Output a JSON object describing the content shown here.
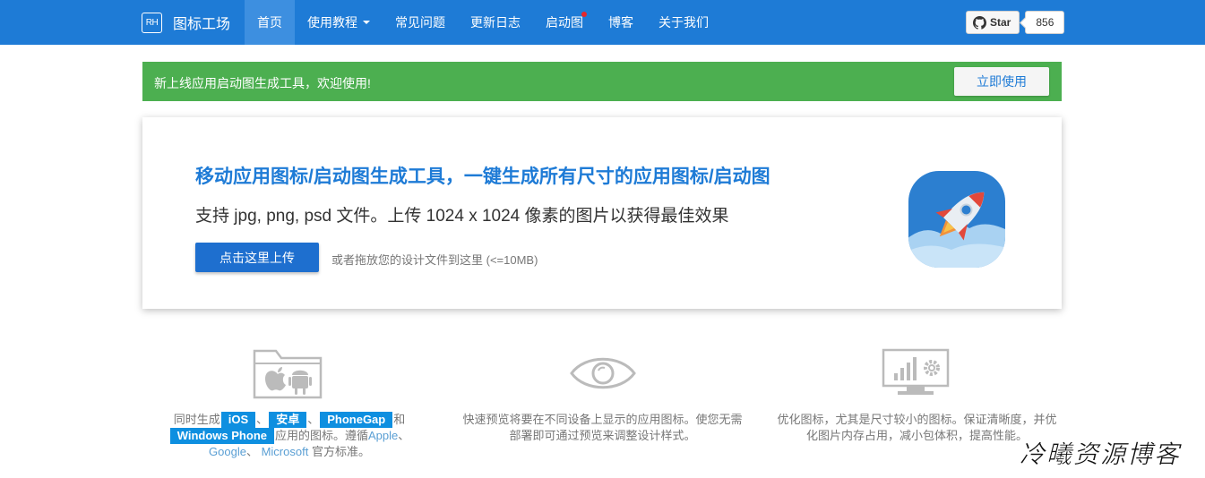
{
  "brand": {
    "logo_text": "RH",
    "name": "图标工场"
  },
  "nav": {
    "items": [
      {
        "label": "首页",
        "active": true
      },
      {
        "label": "使用教程",
        "dropdown": true
      },
      {
        "label": "常见问题"
      },
      {
        "label": "更新日志"
      },
      {
        "label": "启动图",
        "badge_dot": true
      },
      {
        "label": "博客"
      },
      {
        "label": "关于我们"
      }
    ]
  },
  "github": {
    "star_label": "Star",
    "star_count": "856"
  },
  "alert": {
    "text": "新上线应用启动图生成工具，欢迎使用!",
    "button": "立即使用"
  },
  "hero": {
    "title": "移动应用图标/启动图生成工具，一键生成所有尺寸的应用图标/启动图",
    "subtitle": "支持 jpg, png, psd 文件。上传 1024 x 1024 像素的图片以获得最佳效果",
    "upload_button": "点击这里上传",
    "drag_hint": "或者拖放您的设计文件到这里 (<=10MB)"
  },
  "features": {
    "f1": {
      "pre": "同时生成",
      "tag_ios": "iOS",
      "sep1": "、",
      "tag_android": "安卓",
      "sep2": "、",
      "tag_phonegap": "PhoneGap",
      "and": "和",
      "tag_wp": "Windows Phone",
      "mid": "应用的图标。遵循",
      "link_apple": "Apple",
      "sep3": "、",
      "link_google": "Google",
      "sep4": "、",
      "link_ms": "Microsoft",
      "post": "官方标准。"
    },
    "f2": {
      "line1": "快速预览将要在不同设备上显示的应用图标。使您无需",
      "line2": "部署即可通过预览来调整设计样式。"
    },
    "f3": {
      "line1": "优化图标，尤其是尺寸较小的图标。保证清晰度，并优",
      "line2": "化图片内存占用，减小包体积，提高性能。"
    }
  },
  "watermark": "冷曦资源博客",
  "colors": {
    "primary": "#1e7bd6",
    "success": "#4caf50",
    "tag": "#0e8fe0"
  }
}
